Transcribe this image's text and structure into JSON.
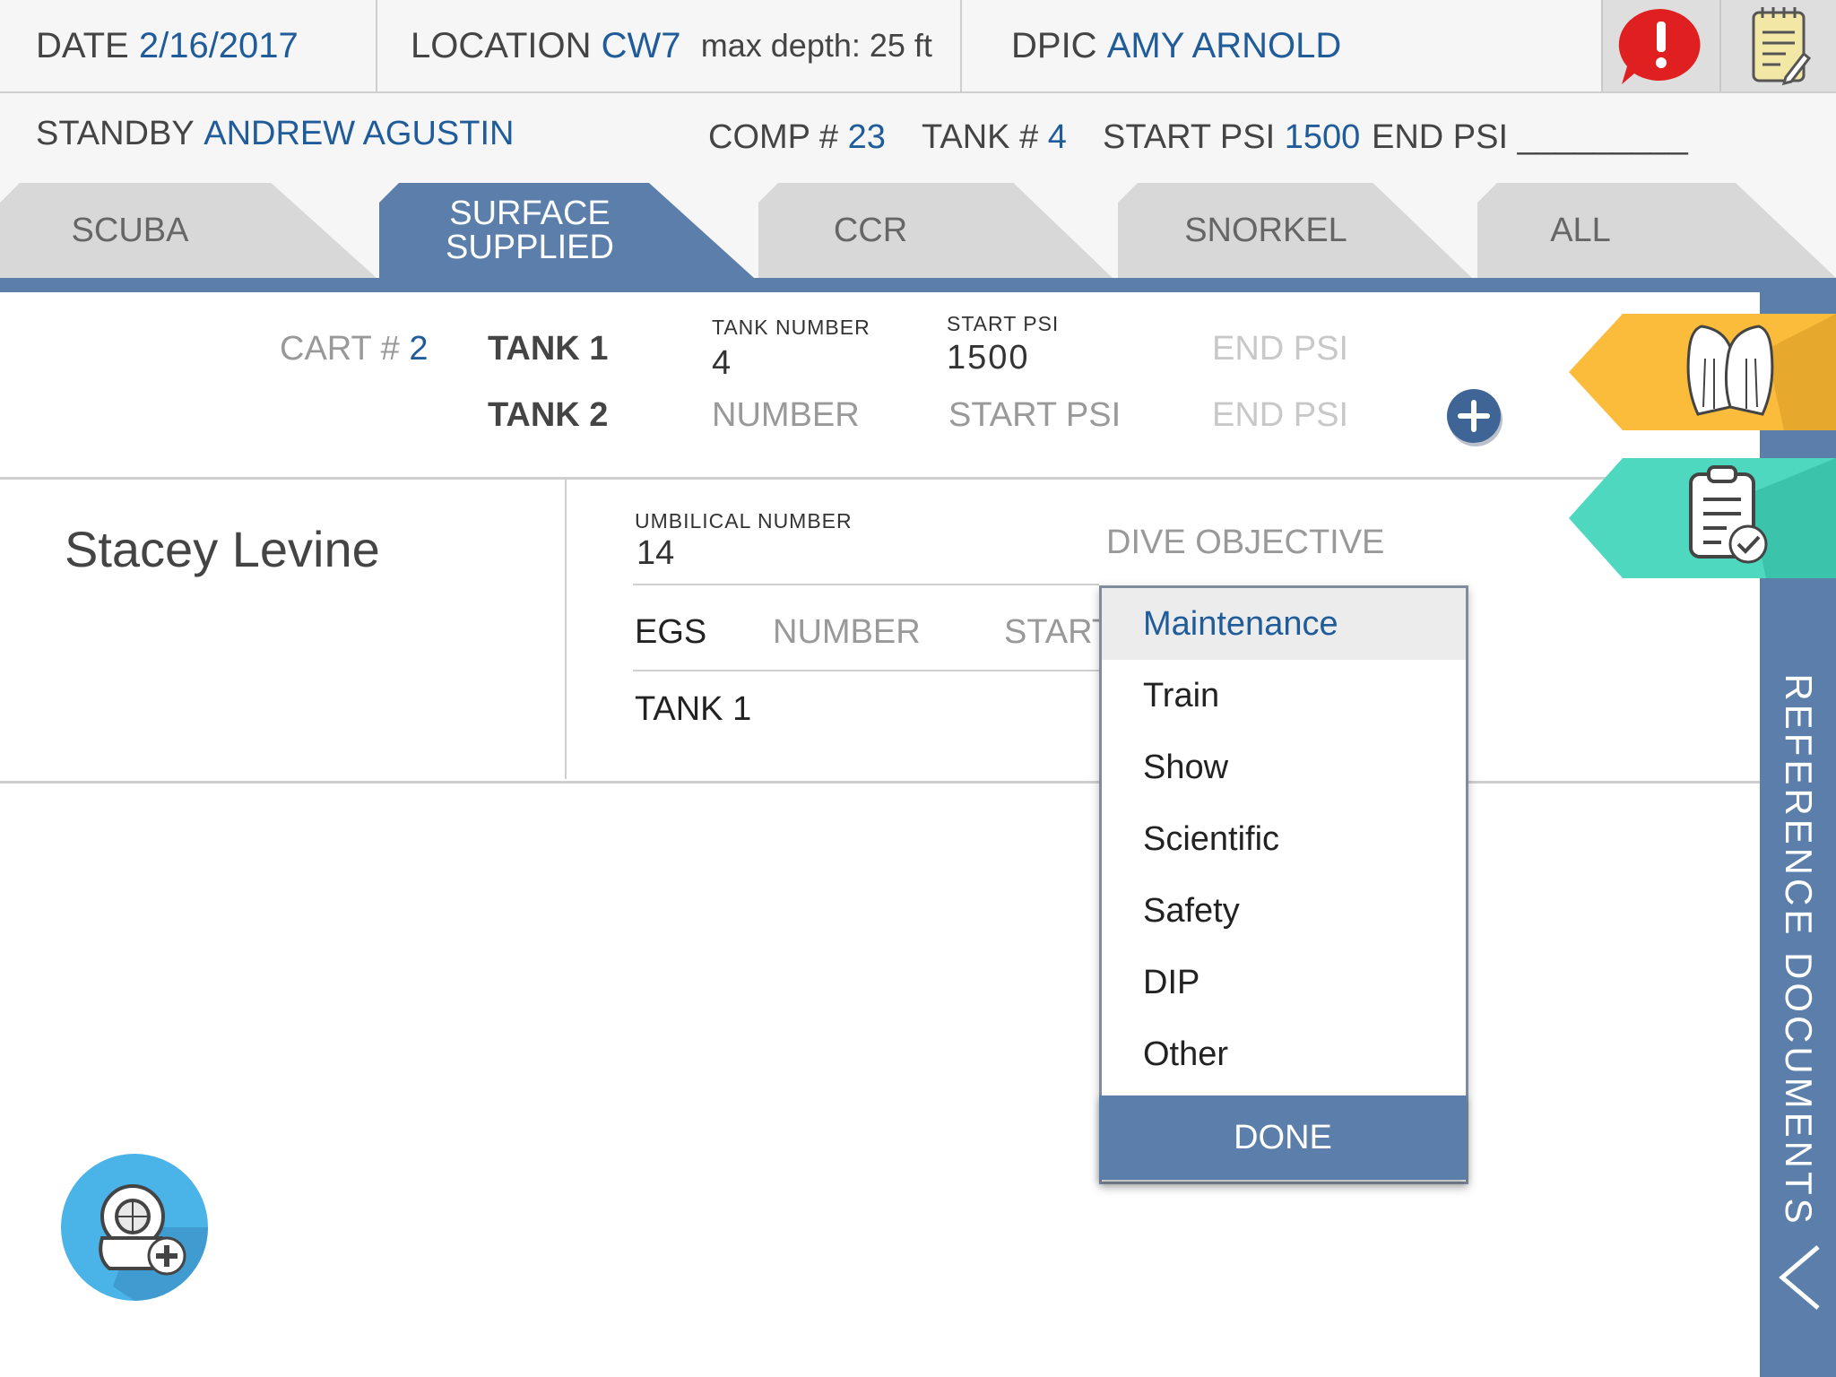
{
  "header": {
    "date_label": "DATE",
    "date_value": "2/16/2017",
    "location_label": "LOCATION",
    "location_value": "CW7",
    "max_depth": "max depth: 25 ft",
    "dpic_label": "DPIC",
    "dpic_value": "AMY ARNOLD",
    "standby_label": "STANDBY",
    "standby_value": "ANDREW AGUSTIN",
    "comp_label": "COMP #",
    "comp_value": "23",
    "tank_label": "TANK #",
    "tank_value": "4",
    "start_psi_label": "START PSI",
    "start_psi_value": "1500",
    "end_psi_label": "END PSI",
    "end_psi_value": "_________"
  },
  "tabs": [
    {
      "label": "SCUBA"
    },
    {
      "label": "SURFACE SUPPLIED",
      "active": true
    },
    {
      "label": "CCR"
    },
    {
      "label": "SNORKEL"
    },
    {
      "label": "ALL"
    }
  ],
  "cart": {
    "cart_label": "CART #",
    "cart_value": "2",
    "tank1_label": "TANK 1",
    "tank1_number_label": "TANK NUMBER",
    "tank1_number": "4",
    "tank1_start_psi_label": "START PSI",
    "tank1_start_psi": "1500",
    "tank1_end_psi_placeholder": "END PSI",
    "tank2_label": "TANK 2",
    "tank2_number_placeholder": "NUMBER",
    "tank2_start_psi_placeholder": "START PSI",
    "tank2_end_psi_placeholder": "END PSI"
  },
  "diver": {
    "name": "Stacey Levine",
    "umbilical_label": "UMBILICAL NUMBER",
    "umbilical_value": "14",
    "dive_objective_placeholder": "DIVE OBJECTIVE",
    "egs_label": "EGS",
    "egs_number_placeholder": "NUMBER",
    "egs_start_placeholder": "START",
    "tank1_label": "TANK 1"
  },
  "dropdown": {
    "options": [
      "Maintenance",
      "Train",
      "Show",
      "Scientific",
      "Safety",
      "DIP",
      "Other"
    ],
    "selected": "Maintenance",
    "done_label": "DONE"
  },
  "sidebar": {
    "reference_documents_label": "REFERENCE DOCUMENTS"
  },
  "colors": {
    "accent_blue": "#5b7faa",
    "value_blue": "#1f5c99",
    "alert_red": "#e02020",
    "fins_tab": "#fbbc3c",
    "checklist_tab": "#4fd8c0",
    "add_diver_button": "#4ab3e8"
  },
  "icons": {
    "alert": "alert-icon",
    "notes": "notepad-icon",
    "fins": "fins-icon",
    "checklist": "clipboard-check-icon",
    "add_tank": "plus-circle-icon",
    "add_diver": "diver-helmet-add-icon",
    "collapse": "chevron-left-icon"
  }
}
